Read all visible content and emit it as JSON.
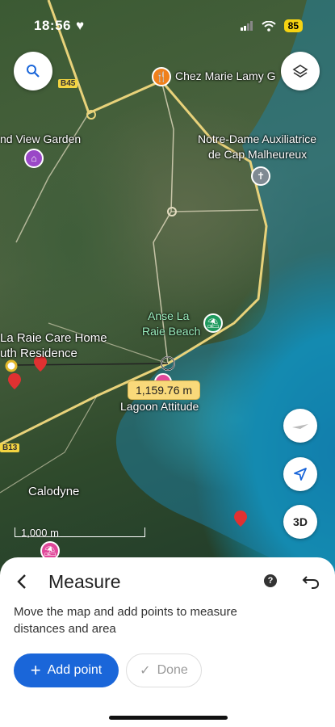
{
  "status_bar": {
    "time": "18:56",
    "battery": "85"
  },
  "map": {
    "places": [
      {
        "name": "Chez Marie Lamy G"
      },
      {
        "name": "nd View Garden"
      },
      {
        "name": "Notre-Dame Auxiliatrice"
      },
      {
        "name": "de Cap Malheureux"
      },
      {
        "name": "Anse La"
      },
      {
        "name": "Raie Beach"
      },
      {
        "name": "La Raie Care Home"
      },
      {
        "name": "uth Residence"
      },
      {
        "name": "Lagoon Attitude"
      },
      {
        "name": "Calodyne"
      }
    ],
    "road_badges": [
      "B45",
      "B13"
    ],
    "measurement": "1,159.76 m",
    "scale_label": "1,000 m",
    "three_d_label": "3D"
  },
  "sheet": {
    "title": "Measure",
    "description": "Move the map and add points to measure distances and area",
    "add_point_label": "Add point",
    "done_label": "Done"
  },
  "icons": {
    "search": "search-icon",
    "layers": "layers-icon",
    "compass": "compass-icon",
    "location": "navigation-arrow-icon",
    "back": "chevron-left-icon",
    "help": "help-icon",
    "undo": "undo-icon",
    "plus": "plus-icon",
    "check": "check-icon"
  },
  "colors": {
    "accent": "#1a66d9",
    "measure_pill": "#f9d97a",
    "road": "#e8d27a"
  }
}
